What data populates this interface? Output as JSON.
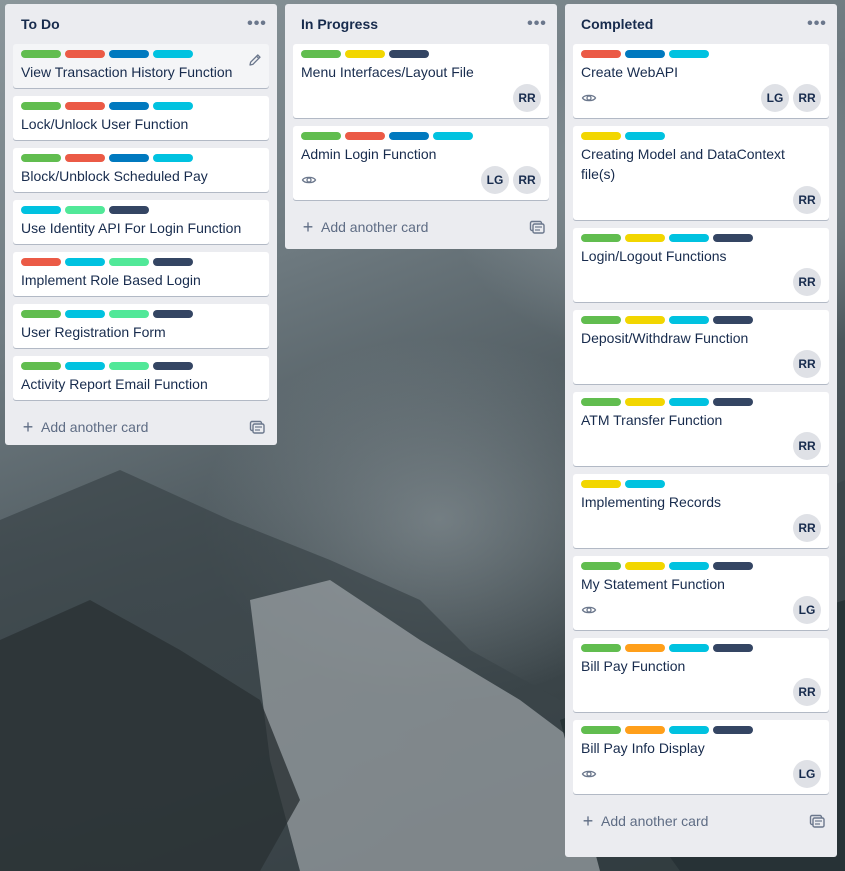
{
  "colors": {
    "green": "#61bd4f",
    "red": "#eb5a46",
    "blue": "#0079bf",
    "sky": "#00c2e0",
    "lime": "#51e898",
    "black": "#344563",
    "yellow": "#f2d600",
    "orange": "#ff9f1a"
  },
  "lists": [
    {
      "title": "To Do",
      "menu": "•••",
      "add_label": "Add another card",
      "cards": [
        {
          "title": "View Transaction History Function",
          "labels": [
            "green",
            "red",
            "blue",
            "sky"
          ],
          "members": [],
          "watch": false,
          "hover": true
        },
        {
          "title": "Lock/Unlock User Function",
          "labels": [
            "green",
            "red",
            "blue",
            "sky"
          ],
          "members": [],
          "watch": false
        },
        {
          "title": "Block/Unblock Scheduled Pay",
          "labels": [
            "green",
            "red",
            "blue",
            "sky"
          ],
          "members": [],
          "watch": false
        },
        {
          "title": "Use Identity API For Login Function",
          "labels": [
            "sky",
            "lime",
            "black"
          ],
          "members": [],
          "watch": false
        },
        {
          "title": "Implement Role Based Login",
          "labels": [
            "red",
            "sky",
            "lime",
            "black"
          ],
          "members": [],
          "watch": false
        },
        {
          "title": "User Registration Form",
          "labels": [
            "green",
            "sky",
            "lime",
            "black"
          ],
          "members": [],
          "watch": false
        },
        {
          "title": "Activity Report Email Function",
          "labels": [
            "green",
            "sky",
            "lime",
            "black"
          ],
          "members": [],
          "watch": false
        }
      ]
    },
    {
      "title": "In Progress",
      "menu": "•••",
      "add_label": "Add another card",
      "cards": [
        {
          "title": "Menu Interfaces/Layout File",
          "labels": [
            "green",
            "yellow",
            "black"
          ],
          "members": [
            "RR"
          ],
          "watch": false
        },
        {
          "title": "Admin Login Function",
          "labels": [
            "green",
            "red",
            "blue",
            "sky"
          ],
          "members": [
            "LG",
            "RR"
          ],
          "watch": true
        }
      ]
    },
    {
      "title": "Completed",
      "menu": "•••",
      "add_label": "Add another card",
      "cards": [
        {
          "title": "Create WebAPI",
          "labels": [
            "red",
            "blue",
            "sky"
          ],
          "members": [
            "LG",
            "RR"
          ],
          "watch": true
        },
        {
          "title": "Creating Model and DataContext file(s)",
          "labels": [
            "yellow",
            "sky"
          ],
          "members": [
            "RR"
          ],
          "watch": false
        },
        {
          "title": "Login/Logout Functions",
          "labels": [
            "green",
            "yellow",
            "sky",
            "black"
          ],
          "members": [
            "RR"
          ],
          "watch": false
        },
        {
          "title": "Deposit/Withdraw Function",
          "labels": [
            "green",
            "yellow",
            "sky",
            "black"
          ],
          "members": [
            "RR"
          ],
          "watch": false
        },
        {
          "title": "ATM Transfer Function",
          "labels": [
            "green",
            "yellow",
            "sky",
            "black"
          ],
          "members": [
            "RR"
          ],
          "watch": false
        },
        {
          "title": "Implementing Records",
          "labels": [
            "yellow",
            "sky"
          ],
          "members": [
            "RR"
          ],
          "watch": false
        },
        {
          "title": "My Statement Function",
          "labels": [
            "green",
            "yellow",
            "sky",
            "black"
          ],
          "members": [
            "LG"
          ],
          "watch": true
        },
        {
          "title": "Bill Pay Function",
          "labels": [
            "green",
            "orange",
            "sky",
            "black"
          ],
          "members": [
            "RR"
          ],
          "watch": false
        },
        {
          "title": "Bill Pay Info Display",
          "labels": [
            "green",
            "orange",
            "sky",
            "black"
          ],
          "members": [
            "LG"
          ],
          "watch": true
        }
      ]
    }
  ]
}
